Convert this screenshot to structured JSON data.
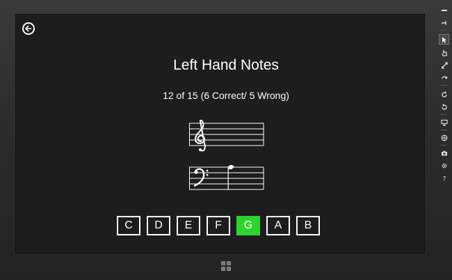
{
  "app": {
    "title": "Left Hand Notes",
    "progress_text": "12 of 15 (6 Correct/ 5 Wrong)"
  },
  "staff": {
    "treble": {
      "clef": "treble-clef-icon"
    },
    "bass": {
      "clef": "bass-clef-icon",
      "note": "G"
    }
  },
  "answers": [
    {
      "label": "C",
      "state": "normal"
    },
    {
      "label": "D",
      "state": "normal"
    },
    {
      "label": "E",
      "state": "normal"
    },
    {
      "label": "F",
      "state": "normal"
    },
    {
      "label": "G",
      "state": "correct"
    },
    {
      "label": "A",
      "state": "normal"
    },
    {
      "label": "B",
      "state": "normal"
    }
  ],
  "colors": {
    "correct": "#2fd32f",
    "background": "#1d1d1d",
    "foreground": "#ffffff"
  },
  "simulator_toolbar": [
    "minimize-icon",
    "pin-icon",
    "mouse-mode-icon",
    "touch-mode-icon",
    "pinch-zoom-icon",
    "rotate-touch-icon",
    "rotate-clockwise-icon",
    "rotate-counterclockwise-icon",
    "change-resolution-icon",
    "set-location-icon",
    "screenshot-icon",
    "settings-icon",
    "help-icon"
  ]
}
